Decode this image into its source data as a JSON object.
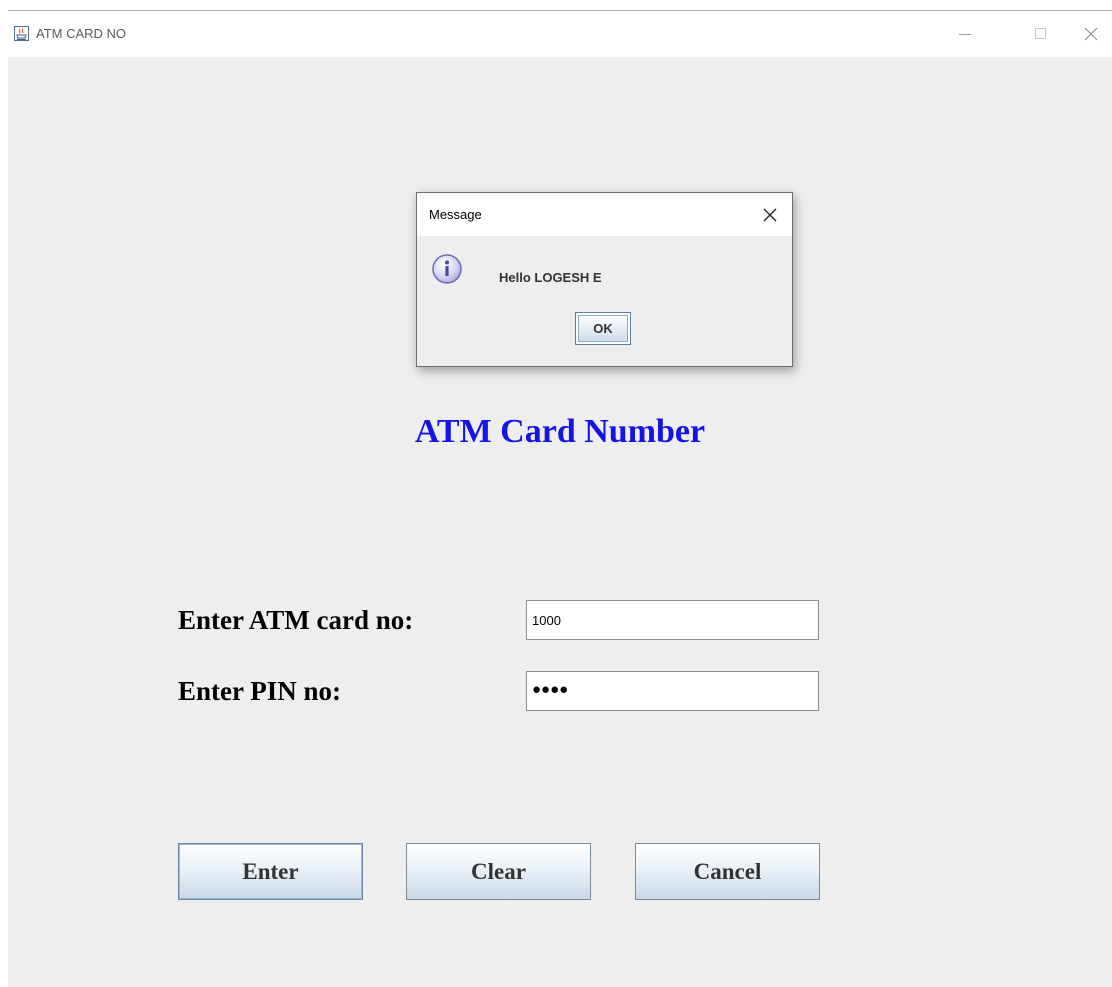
{
  "window": {
    "title": "ATM CARD NO",
    "controls": [
      "minimize",
      "maximize",
      "close"
    ]
  },
  "main": {
    "heading": "ATM Card Number",
    "card_label": "Enter ATM card no:",
    "card_value": "1000",
    "pin_label": "Enter PIN no:",
    "pin_masked": "●●●●"
  },
  "buttons": {
    "enter": "Enter",
    "clear": "Clear",
    "cancel": "Cancel"
  },
  "dialog": {
    "title": "Message",
    "message": "Hello LOGESH E",
    "ok_label": "OK",
    "icon": "info-icon"
  },
  "colors": {
    "heading": "#1414e6",
    "window_background": "#eeeeee",
    "titlebar": "#ffffff"
  }
}
